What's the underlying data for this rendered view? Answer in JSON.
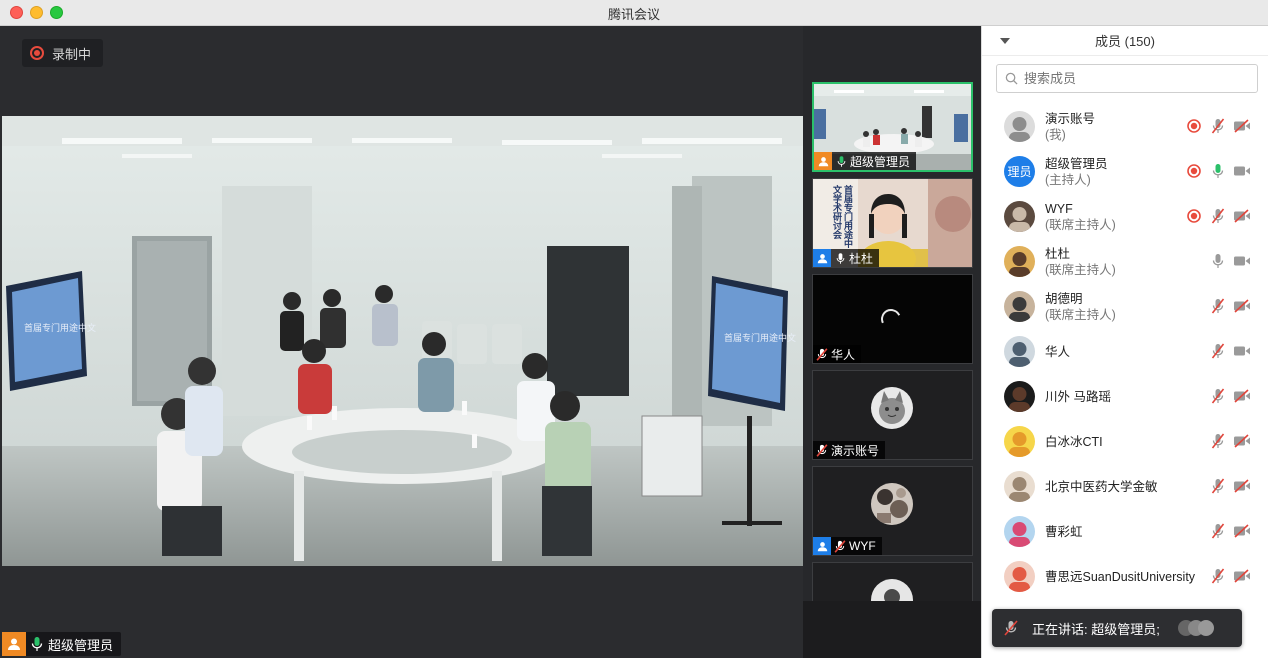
{
  "window": {
    "title": "腾讯会议"
  },
  "recording": {
    "label": "录制中"
  },
  "main_video": {
    "name": "超级管理员"
  },
  "thumbnails": [
    {
      "name": "超级管理员",
      "active": true
    },
    {
      "name": "杜杜"
    },
    {
      "name": "华人"
    },
    {
      "name": "演示账号"
    },
    {
      "name": "WYF"
    },
    {
      "name": ""
    }
  ],
  "screen_signs": {
    "left": "首届专门用途中文学术研讨会",
    "right": "首届专门用途中文学术研讨会",
    "thumb_banner": "首届专门用途中文学术研讨会"
  },
  "panel": {
    "header": "成员 (150)",
    "search_placeholder": "搜索成员",
    "members": [
      {
        "name": "演示账号",
        "role": "(我)",
        "rec": true,
        "mic": "muted",
        "cam": "off"
      },
      {
        "name": "超级管理员",
        "role": "(主持人)",
        "avatar_text": "理员",
        "rec": true,
        "mic": "on",
        "cam": "on"
      },
      {
        "name": "WYF",
        "role": "(联席主持人)",
        "rec": true,
        "mic": "muted",
        "cam": "off"
      },
      {
        "name": "杜杜",
        "role": "(联席主持人)",
        "rec": false,
        "mic": "idle",
        "cam": "on"
      },
      {
        "name": "胡德明",
        "role": "(联席主持人)",
        "rec": false,
        "mic": "muted",
        "cam": "off"
      },
      {
        "name": "华人",
        "role": "",
        "rec": false,
        "mic": "muted",
        "cam": "on"
      },
      {
        "name": "川外 马路瑶",
        "role": "",
        "rec": false,
        "mic": "muted",
        "cam": "off"
      },
      {
        "name": "白冰冰CTI",
        "role": "",
        "rec": false,
        "mic": "muted",
        "cam": "off"
      },
      {
        "name": "北京中医药大学金敏",
        "role": "",
        "rec": false,
        "mic": "muted",
        "cam": "off"
      },
      {
        "name": "曹彩虹",
        "role": "",
        "rec": false,
        "mic": "muted",
        "cam": "off"
      },
      {
        "name": "曹思远SuanDusitUniversity",
        "role": "",
        "rec": false,
        "mic": "muted",
        "cam": "off"
      }
    ]
  },
  "speaking_toast": {
    "text": "正在讲话: 超级管理员;"
  },
  "colors": {
    "accent_green": "#2bc06a",
    "rec_red": "#e84b3d",
    "mute_red": "#e0453b",
    "user_orange": "#f08a24",
    "user_blue": "#1e7ee8"
  }
}
